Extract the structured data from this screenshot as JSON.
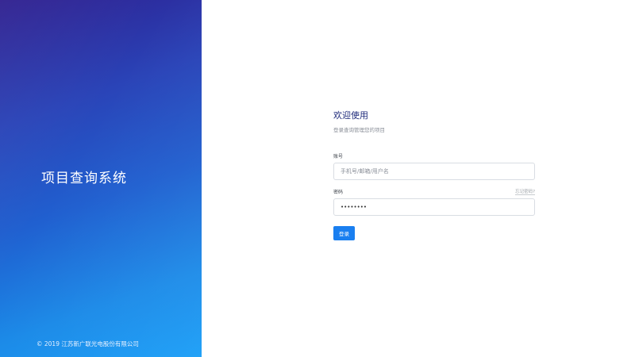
{
  "brand": {
    "system_title": "项目查询系统",
    "copyright": "© 2019 江苏新广联光电股份有限公司"
  },
  "login": {
    "title": "欢迎使用",
    "subtitle": "登录查询管理您的项目",
    "account": {
      "label": "账号",
      "placeholder": "手机号/邮箱/用户名",
      "value": ""
    },
    "password": {
      "label": "密码",
      "forgot_label": "忘记密码?",
      "value": "********"
    },
    "submit_label": "登录"
  },
  "colors": {
    "gradient_start": "#2d1d8e",
    "gradient_end": "#159cf7",
    "primary_button": "#1a7ff0",
    "title_text": "#1f2b7b"
  }
}
